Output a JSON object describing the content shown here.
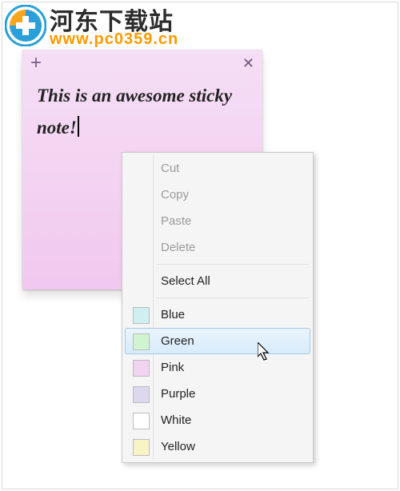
{
  "watermark": {
    "title": "河东下载站",
    "url": "www.pc0359.cn"
  },
  "note": {
    "add_symbol": "+",
    "close_symbol": "✕",
    "text": "This is an awesome sticky note!"
  },
  "menu": {
    "cut": "Cut",
    "copy": "Copy",
    "paste": "Paste",
    "delete": "Delete",
    "select_all": "Select All",
    "colors": {
      "blue": "Blue",
      "green": "Green",
      "pink": "Pink",
      "purple": "Purple",
      "white": "White",
      "yellow": "Yellow"
    },
    "hovered": "green",
    "swatch_hex": {
      "blue": "#cfeff0",
      "green": "#cff4cf",
      "pink": "#f2d3f1",
      "purple": "#ded7f0",
      "white": "#ffffff",
      "yellow": "#f8f4c5"
    }
  }
}
